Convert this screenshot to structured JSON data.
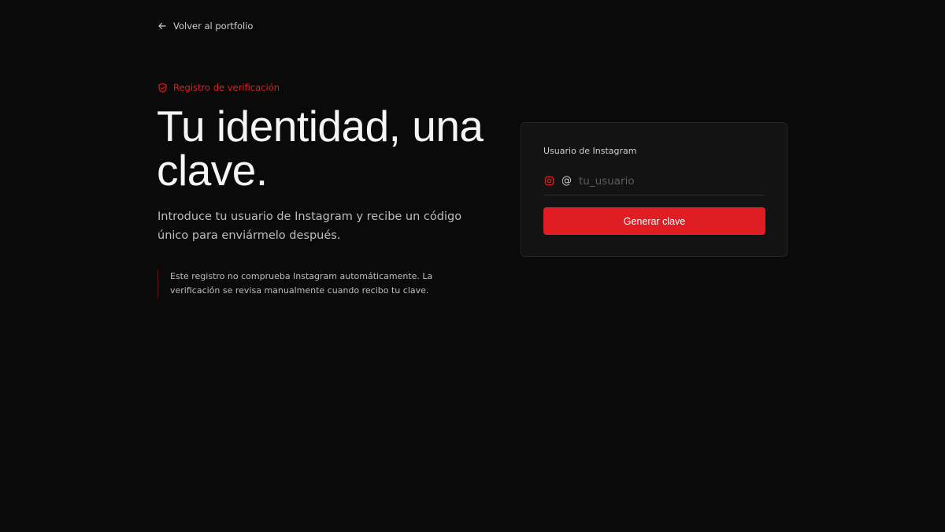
{
  "nav": {
    "back_label": "Volver al portfolio",
    "back_icon": "arrow-left-icon"
  },
  "hero": {
    "badge_label": "Registro de verificación",
    "badge_icon": "shield-icon",
    "headline": "Tu identidad, una clave.",
    "subtitle": "Introduce tu usuario de Instagram y recibe un código único para enviármelo después.",
    "note": "Este registro no comprueba Instagram automáticamente. La verificación se revisa manualmente cuando recibo tu clave."
  },
  "form": {
    "label": "Usuario de Instagram",
    "icon": "instagram-icon",
    "prefix": "@",
    "value": "",
    "placeholder": "tu_usuario",
    "button_label": "Generar clave"
  },
  "colors": {
    "background": "#0a0a0a",
    "accent": "#e11d24",
    "card": "#131313"
  }
}
